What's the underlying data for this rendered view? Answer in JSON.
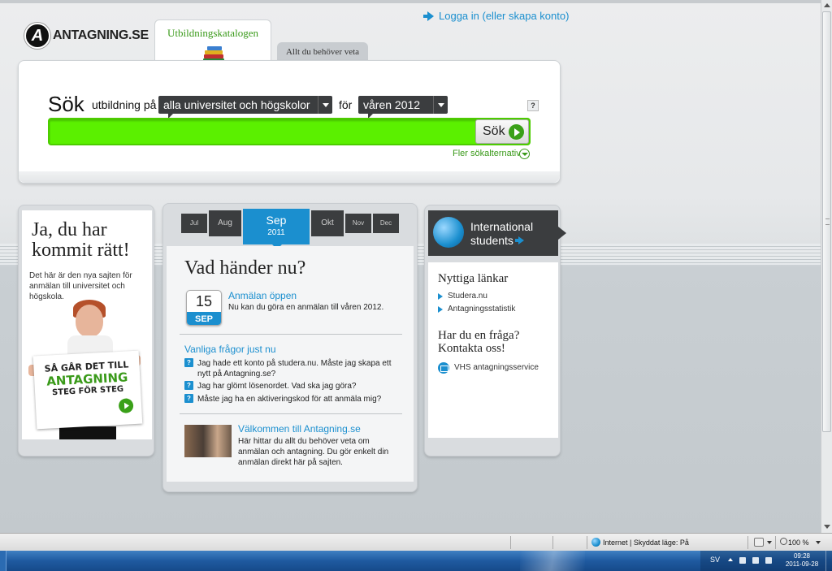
{
  "header": {
    "logo_letter": "A",
    "logo_text": "ANTAGNING.SE",
    "login_link": "Logga in (eller skapa konto)"
  },
  "tabs": [
    {
      "label": "Utbildningskatalogen",
      "active": true
    },
    {
      "label": "Allt du behöver veta",
      "active": false
    }
  ],
  "search": {
    "heading": "Sök",
    "label_utbildning": "utbildning på",
    "scope_select": "alla universitet och högskolor",
    "label_for": "för",
    "term_select": "våren 2012",
    "help": "?",
    "input_value": "",
    "button_label": "Sök",
    "more_options": "Fler sökalternativ"
  },
  "left_panel": {
    "title": "Ja, du har kommit rätt!",
    "description": "Det här är den nya sajten för anmälan till universitet och högskola.",
    "sign_line1": "SÅ GÅR DET TILL",
    "sign_line2": "ANTAGNING",
    "sign_line3": "STEG FÖR STEG"
  },
  "timeline": {
    "months": [
      "Jul",
      "Aug",
      "Okt",
      "Nov",
      "Dec"
    ],
    "active_month": "Sep",
    "active_year": "2011"
  },
  "news": {
    "title": "Vad händer nu?",
    "event": {
      "day": "15",
      "month": "SEP",
      "title": "Anmälan öppen",
      "description": "Nu kan du göra en anmälan till våren 2012."
    },
    "faq_title": "Vanliga frågor just nu",
    "faq": [
      "Jag hade ett konto på studera.nu. Måste jag skapa ett nytt på Antagning.se?",
      "Jag har glömt lösenordet. Vad ska jag göra?",
      "Måste jag ha en aktiveringskod för att anmäla mig?"
    ],
    "welcome_title": "Välkommen till Antagning.se",
    "welcome_text": "Här hittar du allt du behöver veta om anmälan och antagning. Du gör enkelt din anmälan direkt här på sajten."
  },
  "right_panel": {
    "international": "International students",
    "links_title": "Nyttiga länkar",
    "links": [
      "Studera.nu",
      "Antagningsstatistik"
    ],
    "question_title": "Har du en fråga? Kontakta oss!",
    "contact": "VHS antagningsservice"
  },
  "statusbar": {
    "zone": "Internet | Skyddat läge: På",
    "zoom": "100 %"
  },
  "taskbar": {
    "language": "SV",
    "time": "09:28",
    "date": "2011-09-28"
  },
  "colors": {
    "brand_green": "#3a9a1a",
    "search_green": "#5bf000",
    "link_blue": "#1b8fcf",
    "dark_box": "#3b3d3f"
  }
}
